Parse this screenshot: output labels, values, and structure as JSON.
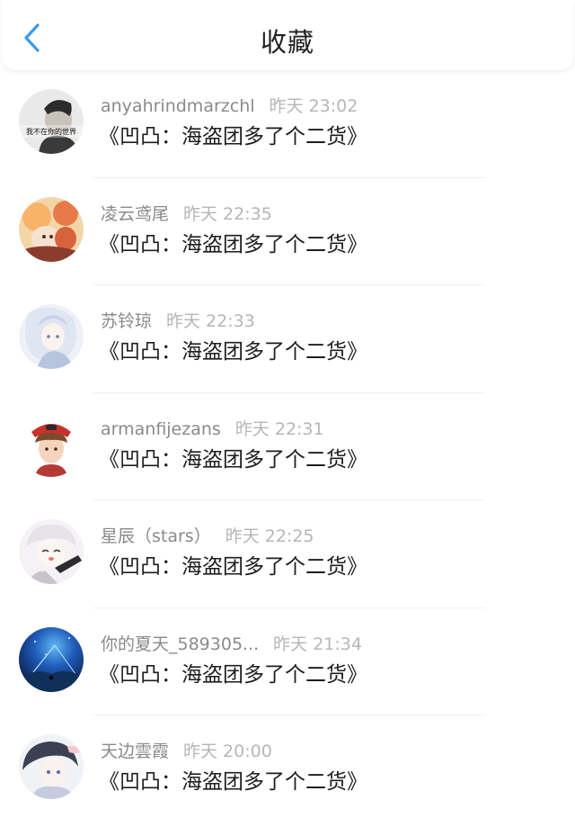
{
  "header": {
    "title": "收藏",
    "back_icon": "chevron-left-icon",
    "accent_color": "#3d9ae8"
  },
  "items": [
    {
      "username": "anyahrindmarzchl",
      "time": "昨天 23:02",
      "title": "《凹凸：海盗团多了个二货》",
      "avatar_text": "我不在你的世界"
    },
    {
      "username": "凌云鸢尾",
      "time": "昨天 22:35",
      "title": "《凹凸：海盗团多了个二货》"
    },
    {
      "username": "苏铃琼",
      "time": "昨天 22:33",
      "title": "《凹凸：海盗团多了个二货》"
    },
    {
      "username": "armanfijezans",
      "time": "昨天 22:31",
      "title": "《凹凸：海盗团多了个二货》"
    },
    {
      "username": "星辰（stars）",
      "time": "昨天 22:25",
      "title": "《凹凸：海盗团多了个二货》"
    },
    {
      "username": "你的夏天_589305...",
      "time": "昨天 21:34",
      "title": "《凹凸：海盗团多了个二货》"
    },
    {
      "username": "天边雲霞",
      "time": "昨天 20:00",
      "title": "《凹凸：海盗团多了个二货》"
    }
  ]
}
